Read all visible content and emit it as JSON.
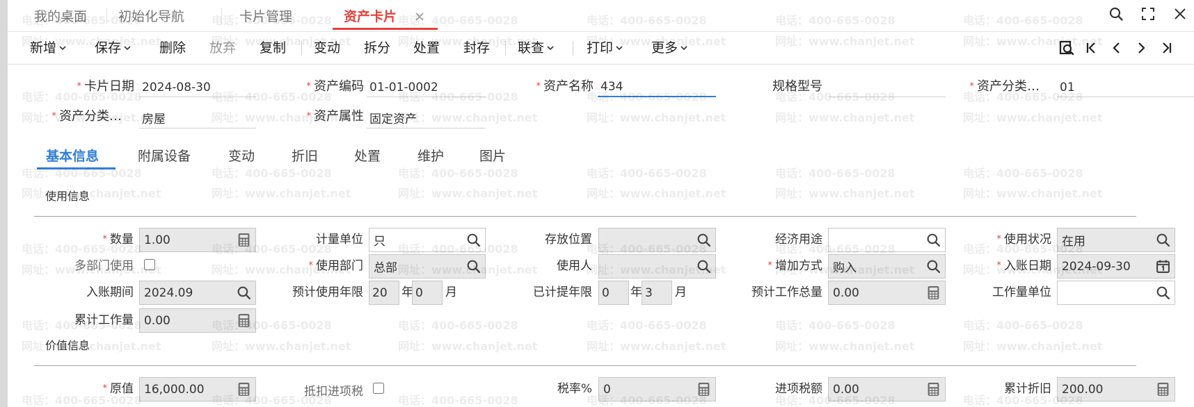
{
  "app": {
    "tabs": [
      {
        "label": "我的桌面"
      },
      {
        "label": "初始化导航"
      },
      {
        "label": "卡片管理"
      },
      {
        "label": "资产卡片",
        "active": true
      }
    ],
    "window_controls": [
      "search-icon",
      "maximize-icon",
      "close-icon"
    ]
  },
  "toolbar": {
    "add": "新增",
    "save": "保存",
    "delete": "删除",
    "discard": "放弃",
    "copy": "复制",
    "change": "变动",
    "split": "拆分",
    "dispose": "处置",
    "seal": "封存",
    "lookup": "联查",
    "print": "打印",
    "more": "更多",
    "discard_disabled": true,
    "nav_icons": [
      "preview-icon",
      "first-record-icon",
      "prev-record-icon",
      "next-record-icon",
      "last-record-icon"
    ]
  },
  "ui": {
    "required_mark": "*"
  },
  "header": {
    "card_date": {
      "label": "卡片日期",
      "value": "2024-08-30",
      "required": true
    },
    "asset_code": {
      "label": "资产编码",
      "value": "01-01-0002",
      "required": true
    },
    "asset_name": {
      "label": "资产名称",
      "value": "434",
      "required": true,
      "focused": true
    },
    "spec_model": {
      "label": "规格型号",
      "value": ""
    },
    "asset_category_code": {
      "label": "资产分类…",
      "value": "01",
      "required": true
    },
    "asset_category_name": {
      "label": "资产分类…",
      "value": "房屋",
      "required": true
    },
    "asset_attribute": {
      "label": "资产属性",
      "value": "固定资产",
      "required": true
    }
  },
  "detail_tabs": [
    {
      "label": "基本信息",
      "active": true
    },
    {
      "label": "附属设备"
    },
    {
      "label": "变动"
    },
    {
      "label": "折旧"
    },
    {
      "label": "处置"
    },
    {
      "label": "维护"
    },
    {
      "label": "图片"
    }
  ],
  "usage": {
    "title": "使用信息",
    "quantity": {
      "label": "数量",
      "value": "1.00",
      "required": true,
      "icon": "calculator-icon"
    },
    "unit": {
      "label": "计量单位",
      "value": "只",
      "icon": "search-icon"
    },
    "location": {
      "label": "存放位置",
      "value": "",
      "icon": "search-icon"
    },
    "economic_use": {
      "label": "经济用途",
      "value": "",
      "icon": "search-icon"
    },
    "status": {
      "label": "使用状况",
      "value": "在用",
      "required": true,
      "icon": "search-icon"
    },
    "multi_dept": {
      "label": "多部门使用",
      "checked": false
    },
    "department": {
      "label": "使用部门",
      "value": "总部",
      "required": true,
      "icon": "search-icon"
    },
    "user": {
      "label": "使用人",
      "value": "",
      "icon": "search-icon"
    },
    "acquire_method": {
      "label": "增加方式",
      "value": "购入",
      "required": true,
      "icon": "search-icon"
    },
    "entry_date": {
      "label": "入账日期",
      "value": "2024-09-30",
      "required": true,
      "icon": "calendar-icon"
    },
    "entry_period": {
      "label": "入账期间",
      "value": "2024.09",
      "icon": "search-icon"
    },
    "expected_life": {
      "label": "预计使用年限",
      "years": "20",
      "months": "0"
    },
    "depreciated_life": {
      "label": "已计提年限",
      "years": "0",
      "months": "3"
    },
    "expected_workload": {
      "label": "预计工作总量",
      "value": "0.00",
      "icon": "calculator-icon"
    },
    "workload_unit": {
      "label": "工作量单位",
      "value": "",
      "icon": "search-icon"
    },
    "accum_workload": {
      "label": "累计工作量",
      "value": "0.00",
      "icon": "calculator-icon"
    }
  },
  "units": {
    "year": "年",
    "month": "月"
  },
  "value": {
    "title": "价值信息",
    "original_value": {
      "label": "原值",
      "value": "16,000.00",
      "required": true,
      "icon": "calculator-icon"
    },
    "deduct_input_tax": {
      "label": "抵扣进项税",
      "checked": false
    },
    "tax_rate": {
      "label": "税率%",
      "value": "0",
      "icon": "calculator-icon"
    },
    "input_tax": {
      "label": "进项税额",
      "value": "0.00",
      "icon": "calculator-icon"
    },
    "accum_depreciation": {
      "label": "累计折旧",
      "value": "200.00",
      "icon": "calculator-icon"
    }
  },
  "watermark": {
    "phone": "电话：400-665-0028",
    "url": "网址：www.chanjet.net"
  },
  "colors": {
    "active_tab": "#e8413c",
    "accent": "#2f7fd8",
    "readonly_bg": "#e8e8e8"
  }
}
